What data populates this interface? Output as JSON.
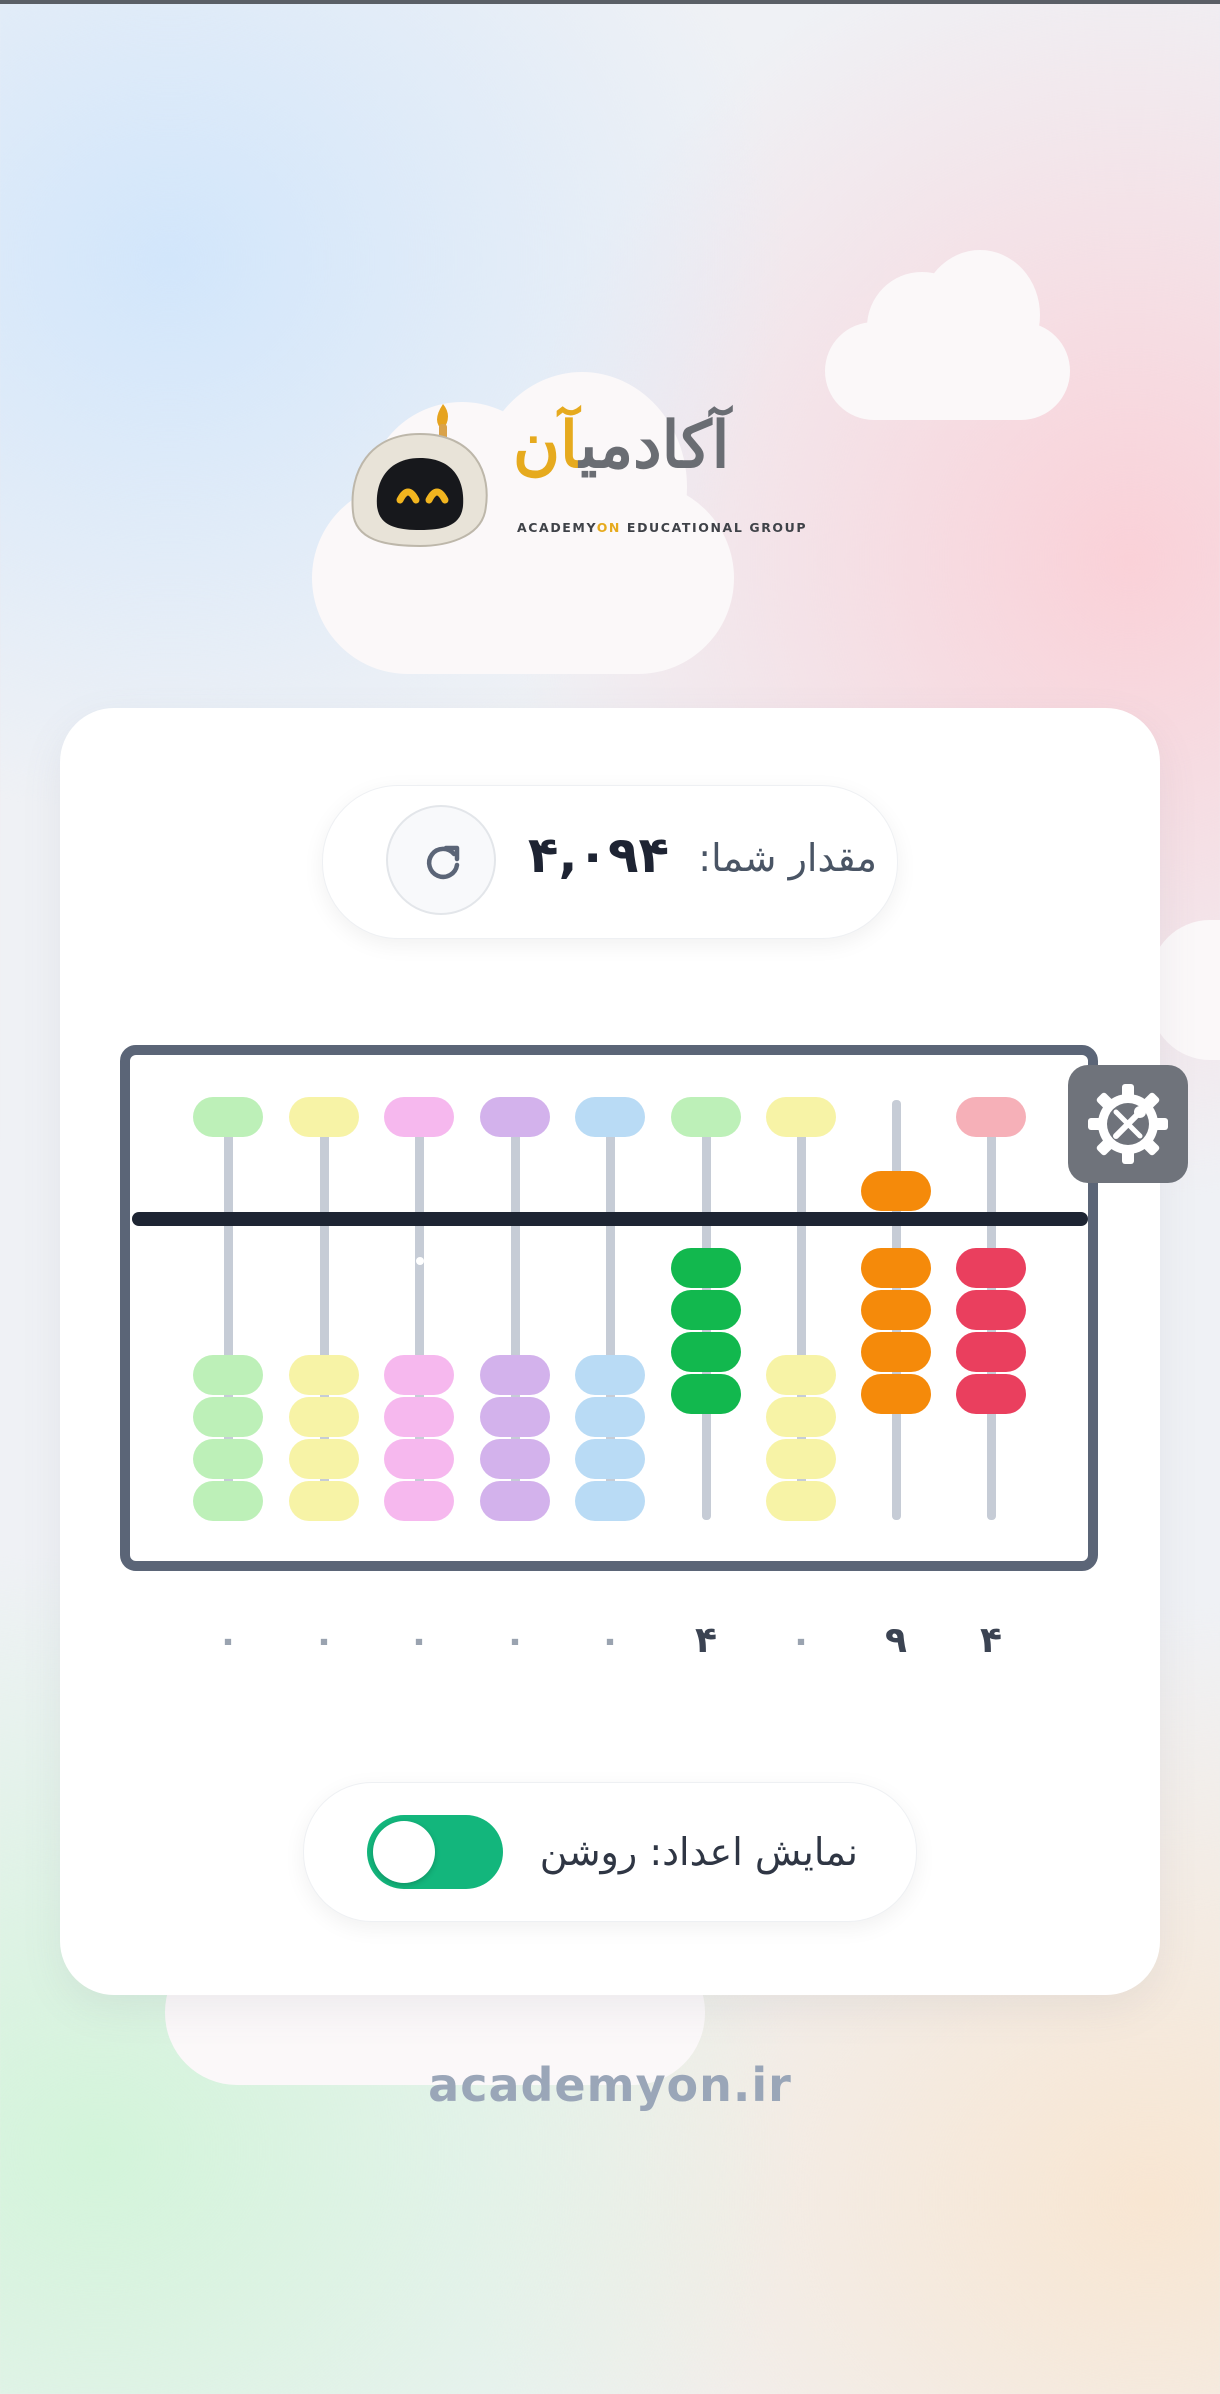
{
  "brand": {
    "name_fa_main": "آکادمی",
    "name_fa_accent": "آن",
    "name_en_a": "ACADEMY",
    "name_en_b": "ON",
    "name_en_c": " EDUCATIONAL GROUP"
  },
  "value_display": {
    "label": "مقدار شما:",
    "value": "۴,۰۹۴",
    "reset_icon": "refresh-icon"
  },
  "abacus": {
    "settings_icon": "tools-gear-icon",
    "digits": [
      "۰",
      "۰",
      "۰",
      "۰",
      "۰",
      "۴",
      "۰",
      "۹",
      "۴"
    ],
    "colors": {
      "green_light": "#bdf0b8",
      "yellow_light": "#f7f3a6",
      "pink_light": "#f6b8ee",
      "purple_light": "#d3b2ec",
      "blue_light": "#b9dbf5",
      "green_active": "#12b84e",
      "orange_active": "#f58a0a",
      "red_active": "#ea3f5e",
      "red_light": "#f6b0b8"
    }
  },
  "toggle": {
    "label": "نمایش اعداد: روشن",
    "state": "on",
    "color": "#13b67c"
  },
  "footer": {
    "url": "academyon.ir"
  }
}
